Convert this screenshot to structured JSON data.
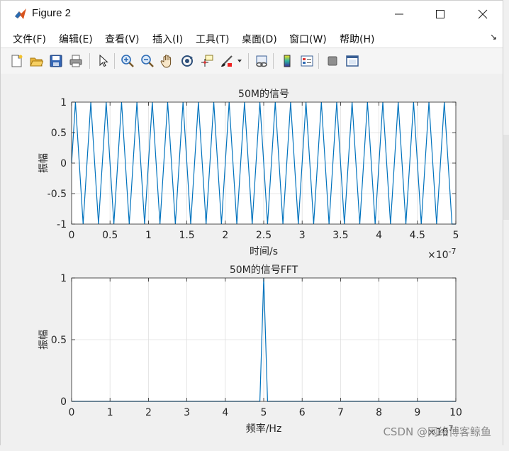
{
  "window": {
    "title": "Figure 2"
  },
  "menu": {
    "items": [
      "文件(F)",
      "编辑(E)",
      "查看(V)",
      "插入(I)",
      "工具(T)",
      "桌面(D)",
      "窗口(W)",
      "帮助(H)"
    ],
    "expand": "↘"
  },
  "toolbar": {
    "icons": [
      "new-figure-icon",
      "open-file-icon",
      "save-icon",
      "print-icon",
      "pointer-icon",
      "zoom-in-icon",
      "zoom-out-icon",
      "pan-hand-icon",
      "rotate-3d-icon",
      "data-cursor-icon",
      "brush-icon",
      "link-plot-icon",
      "colorbar-icon",
      "legend-icon",
      "hide-plot-tools-icon",
      "show-plot-tools-icon"
    ]
  },
  "colors": {
    "line": "#0072bd",
    "grid": "#dfdfdf",
    "axes_bg": "#ffffff",
    "axes_edge": "#262626"
  },
  "chart_data": [
    {
      "type": "line",
      "title": "50M的信号",
      "xlabel": "时间/s",
      "ylabel": "振幅",
      "xlim": [
        0,
        5e-07
      ],
      "ylim": [
        -1,
        1
      ],
      "xticks": [
        "0",
        "0.5",
        "1",
        "1.5",
        "2",
        "2.5",
        "3",
        "3.5",
        "4",
        "4.5",
        "5"
      ],
      "yticks": [
        "1",
        "0.5",
        "0",
        "-0.5",
        "-1"
      ],
      "x_exponent": "×10",
      "x_exponent_power": "-7",
      "grid": true,
      "signal": {
        "shape": "triangle",
        "frequency_hz": 50000000.0,
        "sample_interval_s": 5e-09,
        "x": [
          0,
          5e-09,
          1e-08,
          1.5e-08,
          2e-08,
          5e-07
        ],
        "y": [
          0,
          1,
          0,
          -1,
          0,
          -1
        ],
        "note": "repeats with period 2e-8 s, samples alternate 0, 1, 0, -1"
      }
    },
    {
      "type": "line",
      "title": "50M的信号FFT",
      "xlabel": "频率/Hz",
      "ylabel": "振幅",
      "xlim": [
        0,
        100000000.0
      ],
      "ylim": [
        0,
        1
      ],
      "xticks": [
        "0",
        "1",
        "2",
        "3",
        "4",
        "5",
        "6",
        "7",
        "8",
        "9",
        "10"
      ],
      "yticks": [
        "1",
        "0.5",
        "0"
      ],
      "x_exponent": "×10",
      "x_exponent_power": "7",
      "grid": true,
      "x": [
        0,
        49000000.0,
        50000000.0,
        51000000.0,
        100000000.0
      ],
      "y": [
        0,
        0,
        1,
        0,
        0
      ]
    }
  ],
  "watermark": "CSDN @网络博客鲸鱼"
}
